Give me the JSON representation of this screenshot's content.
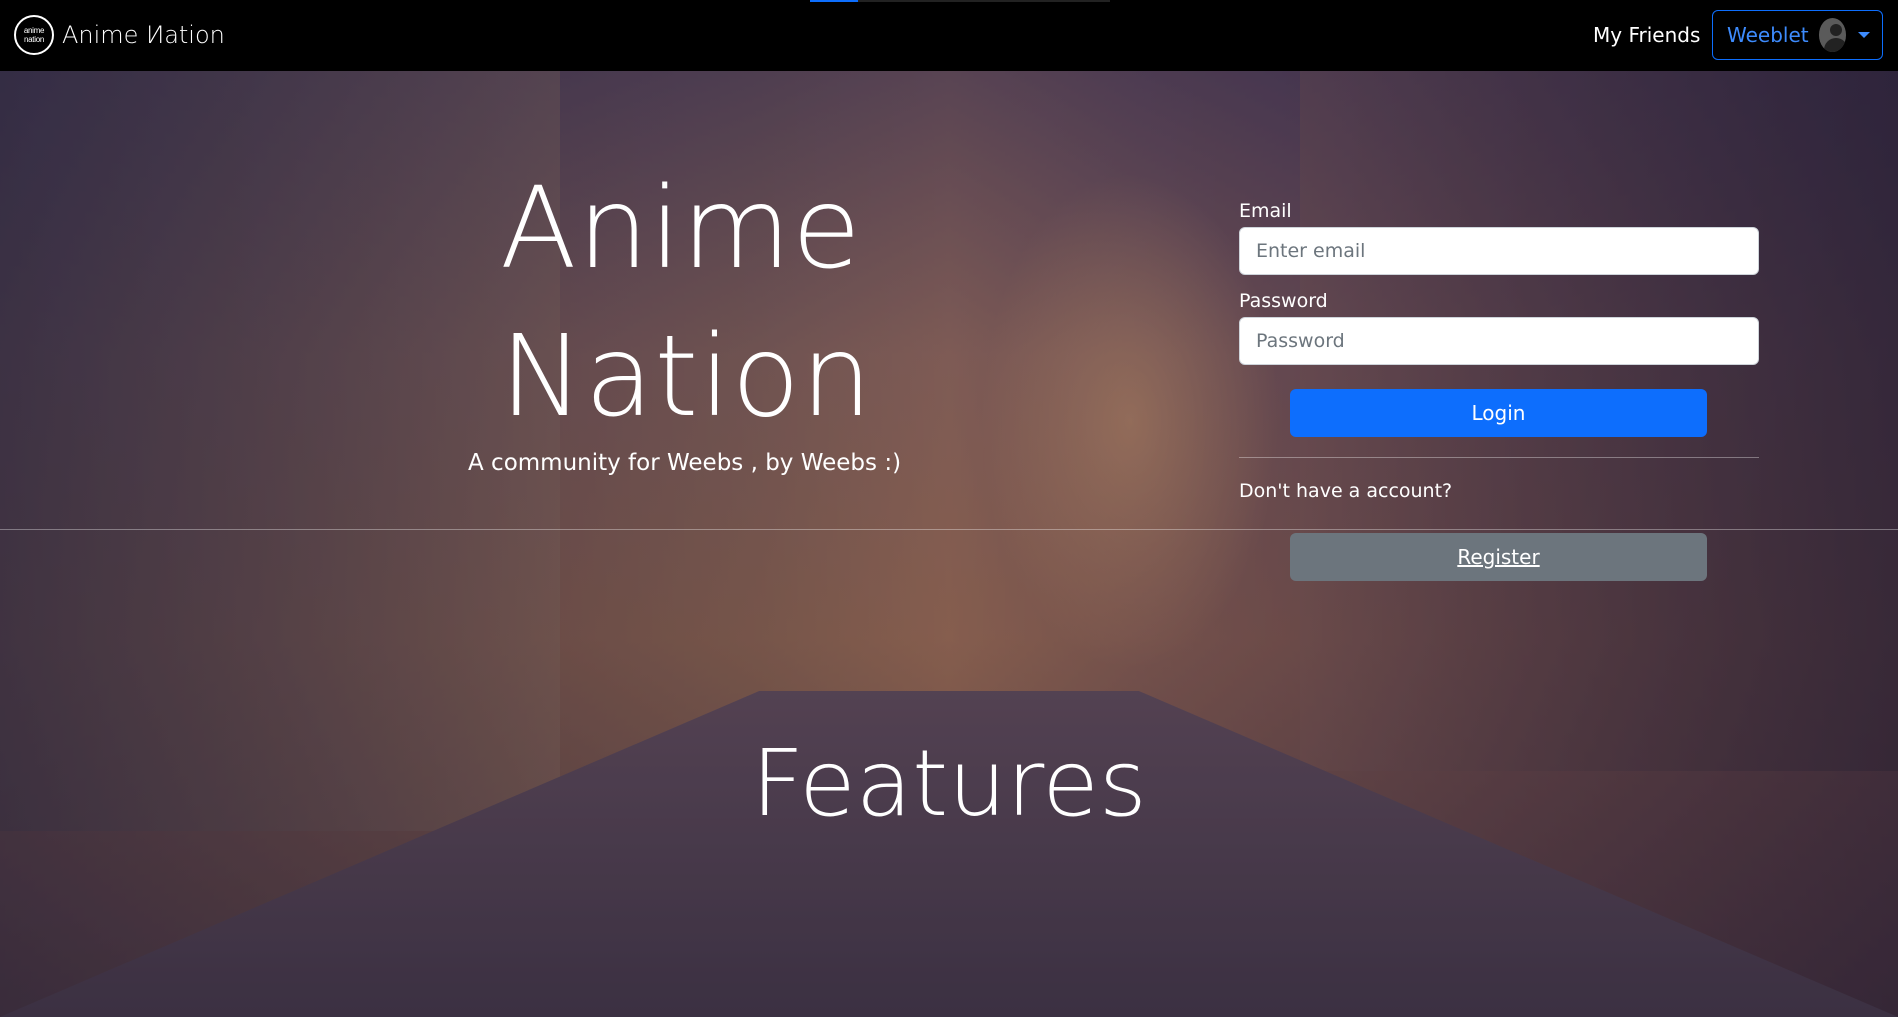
{
  "nav": {
    "logo_line1": "anime",
    "logo_line2": "nation",
    "brand": "Anime Иation",
    "friends_link": "My Friends",
    "user_name": "Weeblet",
    "avatar_icon": "user-avatar-icon",
    "dropdown_icon": "caret-down-icon",
    "accent_color": "#0d6efd"
  },
  "hero": {
    "title_line1": "Anime",
    "title_line2": "Nation",
    "subtitle": "A community for Weebs , by Weebs :)"
  },
  "login_form": {
    "email_label": "Email",
    "email_placeholder": "Enter email",
    "email_value": "",
    "password_label": "Password",
    "password_placeholder": "Password",
    "password_value": "",
    "login_button": "Login",
    "signup_prompt": "Don't have a account?",
    "register_button": "Register"
  },
  "features": {
    "heading": "Features"
  }
}
